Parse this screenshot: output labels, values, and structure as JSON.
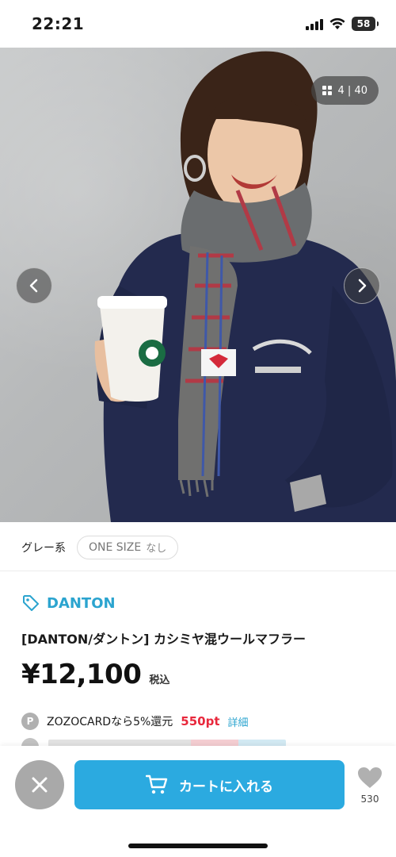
{
  "status_bar": {
    "time": "22:21",
    "battery": "58"
  },
  "gallery": {
    "counter": "4 | 40"
  },
  "options": {
    "color": "グレー系",
    "size": "ONE SIZE",
    "stock": "なし"
  },
  "product": {
    "brand": "DANTON",
    "name": "[DANTON/ダントン] カシミヤ混ウールマフラー",
    "price": "¥12,100",
    "tax_label": "税込"
  },
  "points": {
    "badge": "P",
    "text": "ZOZOCARDなら5%還元",
    "amount": "550pt",
    "link": "詳細"
  },
  "actions": {
    "cart_label": "カートに入れる",
    "favorite_count": "530"
  },
  "colors": {
    "accent": "#2baae0",
    "brand_blue": "#2ba4cf",
    "points_red": "#e8283c"
  },
  "icons": [
    "signal-icon",
    "wifi-icon",
    "battery-icon",
    "grid-icon",
    "chevron-left-icon",
    "chevron-right-icon",
    "tag-icon",
    "close-icon",
    "cart-icon",
    "heart-icon"
  ]
}
